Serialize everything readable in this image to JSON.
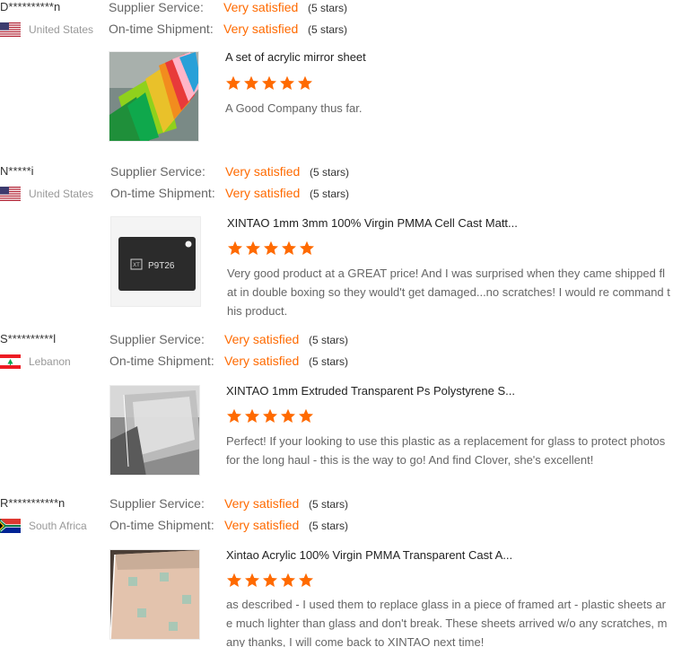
{
  "labels": {
    "supplier_service": "Supplier Service:",
    "on_time_shipment": "On-time Shipment:"
  },
  "colors": {
    "accent": "#ff6a00",
    "star": "#ff6a00"
  },
  "reviews": [
    {
      "buyer": "D**********n",
      "country": "United States",
      "flag": "us-flag",
      "supplier_service": "Very satisfied",
      "supplier_stars": "(5 stars)",
      "shipment": "Very satisfied",
      "shipment_stars": "(5 stars)",
      "product_title": "A set of acrylic mirror sheet",
      "rating": 5,
      "comment": "A Good Company thus far."
    },
    {
      "buyer": "N*****i",
      "country": "United States",
      "flag": "us-flag",
      "supplier_service": "Very satisfied",
      "supplier_stars": "(5 stars)",
      "shipment": "Very satisfied",
      "shipment_stars": "(5 stars)",
      "product_title": "XINTAO 1mm 3mm 100% Virgin PMMA Cell Cast Matt...",
      "rating": 5,
      "comment": "Very good product at a GREAT price! And I was surprised when they came shipped flat in double boxing so they would't get damaged...no scratches! I would re command this product."
    },
    {
      "buyer": "S**********l",
      "country": "Lebanon",
      "flag": "lebanon-flag",
      "supplier_service": "Very satisfied",
      "supplier_stars": "(5 stars)",
      "shipment": "Very satisfied",
      "shipment_stars": "(5 stars)",
      "product_title": "XINTAO 1mm Extruded Transparent Ps Polystyrene S...",
      "rating": 5,
      "comment": "Perfect! If your looking to use this plastic as a replacement for glass to protect photos for the long haul - this is the way to go! And find Clover, she's excellent!"
    },
    {
      "buyer": "R***********n",
      "country": "South Africa",
      "flag": "south-africa-flag",
      "supplier_service": "Very satisfied",
      "supplier_stars": "(5 stars)",
      "shipment": "Very satisfied",
      "shipment_stars": "(5 stars)",
      "product_title": "Xintao Acrylic 100% Virgin PMMA Transparent Cast A...",
      "rating": 5,
      "comment": "as described - I used them to replace glass in a piece of framed art - plastic sheets are much lighter than glass and don't break. These sheets arrived w/o any scratches, many thanks, I will come back to XINTAO next time!"
    }
  ],
  "thumb_text": {
    "sample_code": "P9T26",
    "sample_logo": "XT"
  }
}
